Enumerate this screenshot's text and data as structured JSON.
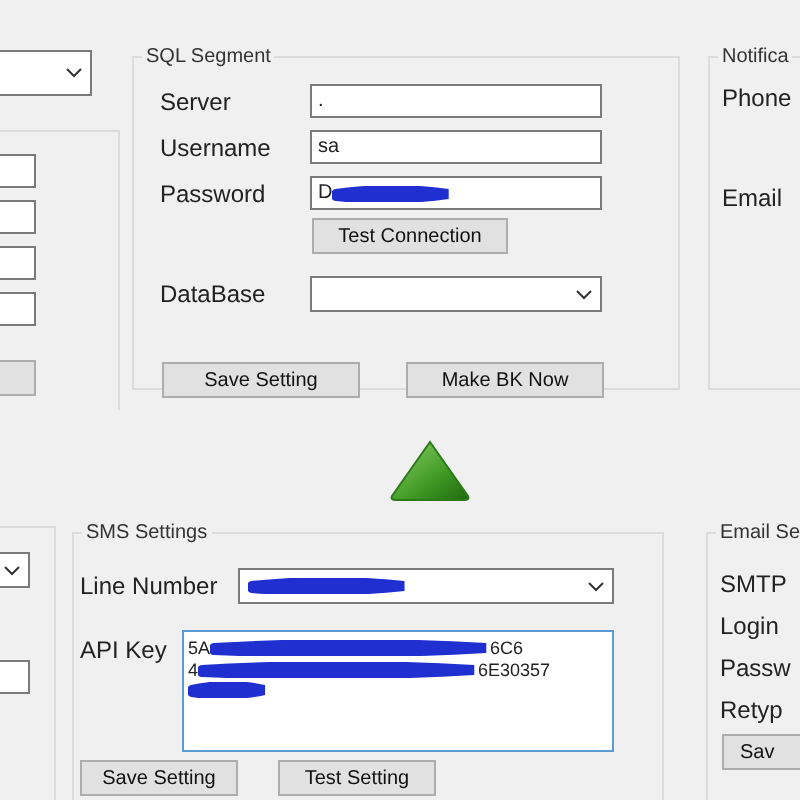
{
  "sql_segment": {
    "title": "SQL Segment",
    "fields": [
      {
        "label": "Server",
        "value": "."
      },
      {
        "label": "Username",
        "value": "sa"
      },
      {
        "label": "Password",
        "value": "D",
        "redacted": true
      }
    ],
    "test_button": "Test Connection",
    "database": {
      "label": "DataBase"
    },
    "buttons": [
      "Save Setting",
      "Make BK Now"
    ]
  },
  "notification": {
    "title": "Notifica",
    "labels": [
      "Phone",
      "Email"
    ]
  },
  "sms_settings": {
    "title": "SMS Settings",
    "line_number": {
      "label": "Line Number",
      "redacted": true
    },
    "api_key": {
      "label": "API Key",
      "lines": [
        [
          "5A",
          "6C6"
        ],
        [
          "4",
          "6E30357"
        ]
      ],
      "trailing_redacted": true
    },
    "buttons": [
      "Save Setting",
      "Test Setting"
    ]
  },
  "email_settings": {
    "title": "Email Se",
    "labels": [
      "SMTP",
      "Login",
      "Passw",
      "Retyp"
    ],
    "button": "Sav"
  }
}
